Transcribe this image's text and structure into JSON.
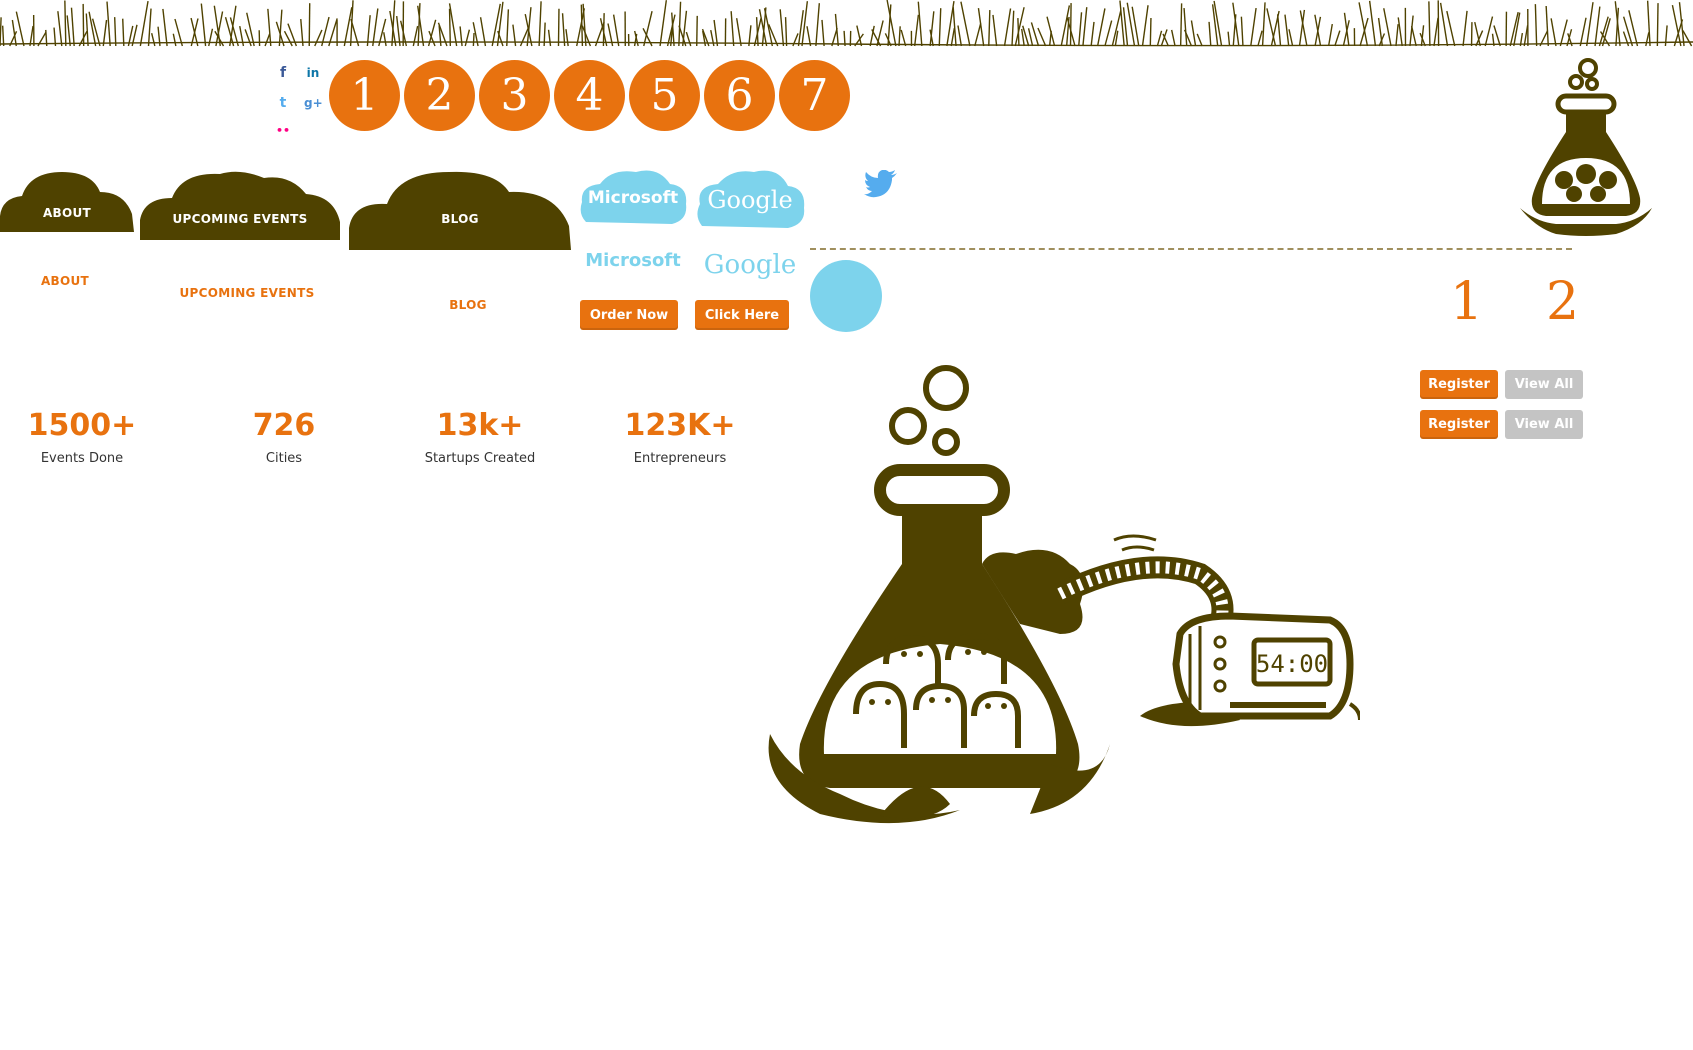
{
  "colors": {
    "accent": "#e8720f",
    "cloud": "#4f4200",
    "sponsor_blue": "#7dd3ec",
    "twitter_blue": "#55acee",
    "button_gray": "#c4c4c4"
  },
  "social_icons": [
    {
      "name": "facebook-icon",
      "glyph": "f",
      "color": "#3b5998"
    },
    {
      "name": "linkedin-icon",
      "glyph": "in",
      "color": "#0e76a8"
    },
    {
      "name": "twitter-icon",
      "glyph": "t",
      "color": "#55acee"
    },
    {
      "name": "google-plus-icon",
      "glyph": "g+",
      "color": "#4a8fd4"
    },
    {
      "name": "flickr-icon",
      "glyph": "••",
      "color": "#ff0084"
    }
  ],
  "number_circles": [
    "1",
    "2",
    "3",
    "4",
    "5",
    "6",
    "7"
  ],
  "nav_clouds": {
    "about": "ABOUT",
    "upcoming": "UPCOMING EVENTS",
    "blog": "BLOG"
  },
  "nav_text": {
    "about": "ABOUT",
    "upcoming": "UPCOMING EVENTS",
    "blog": "BLOG"
  },
  "sponsors": {
    "microsoft_cloud": "Microsoft",
    "google_cloud": "Google",
    "microsoft_plain": "Microsoft",
    "google_plain": "Google"
  },
  "buttons": {
    "order_now": "Order Now",
    "click_here": "Click Here",
    "register_1": "Register",
    "view_all_1": "View All",
    "register_2": "Register",
    "view_all_2": "View All"
  },
  "pager": {
    "first": "1",
    "second": "2"
  },
  "stats": [
    {
      "value": "1500+",
      "label": "Events Done"
    },
    {
      "value": "726",
      "label": "Cities"
    },
    {
      "value": "13k+",
      "label": "Startups Created"
    },
    {
      "value": "123K+",
      "label": "Entrepreneurs"
    }
  ],
  "clock": {
    "display": "54:00"
  }
}
